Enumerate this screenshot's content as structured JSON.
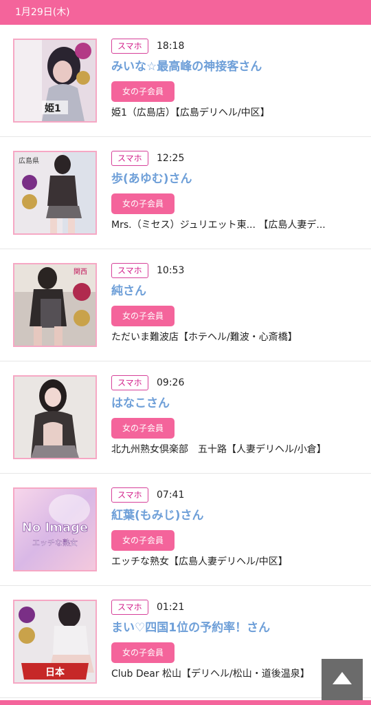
{
  "header": {
    "date": "1月29日(木)"
  },
  "posts": [
    {
      "device": "スマホ",
      "time": "18:18",
      "name": "みいな☆最高峰の神接客さん",
      "badge": "女の子会員",
      "shop": "姫1（広島店）【広島デリヘル/中区】",
      "thumb_text": "姫1"
    },
    {
      "device": "スマホ",
      "time": "12:25",
      "name": "歩(あゆむ)さん",
      "badge": "女の子会員",
      "shop": "Mrs.（ミセス）ジュリエット東...  【広島人妻デ...",
      "thumb_text": "広島県"
    },
    {
      "device": "スマホ",
      "time": "10:53",
      "name": "純さん",
      "badge": "女の子会員",
      "shop": "ただいま難波店【ホテヘル/難波・心斎橋】",
      "thumb_text": "関西"
    },
    {
      "device": "スマホ",
      "time": "09:26",
      "name": "はなこさん",
      "badge": "女の子会員",
      "shop": "北九州熟女倶楽部　五十路【人妻デリヘル/小倉】",
      "thumb_text": ""
    },
    {
      "device": "スマホ",
      "time": "07:41",
      "name": "紅葉(もみじ)さん",
      "badge": "女の子会員",
      "shop": "エッチな熟女【広島人妻デリヘル/中区】",
      "thumb_text": "No Image",
      "thumb_sub": "エッチな熟女"
    },
    {
      "device": "スマホ",
      "time": "01:21",
      "name": "まい♡四国1位の予約率！さん",
      "badge": "女の子会員",
      "shop": "Club Dear 松山【デリヘル/松山・道後温泉】",
      "thumb_text": "日本"
    }
  ],
  "scroll_top": {
    "icon": "arrow-up-icon"
  },
  "colors": {
    "accent": "#f4649b",
    "link": "#6e9fd8",
    "badge_border": "#d63f98"
  }
}
